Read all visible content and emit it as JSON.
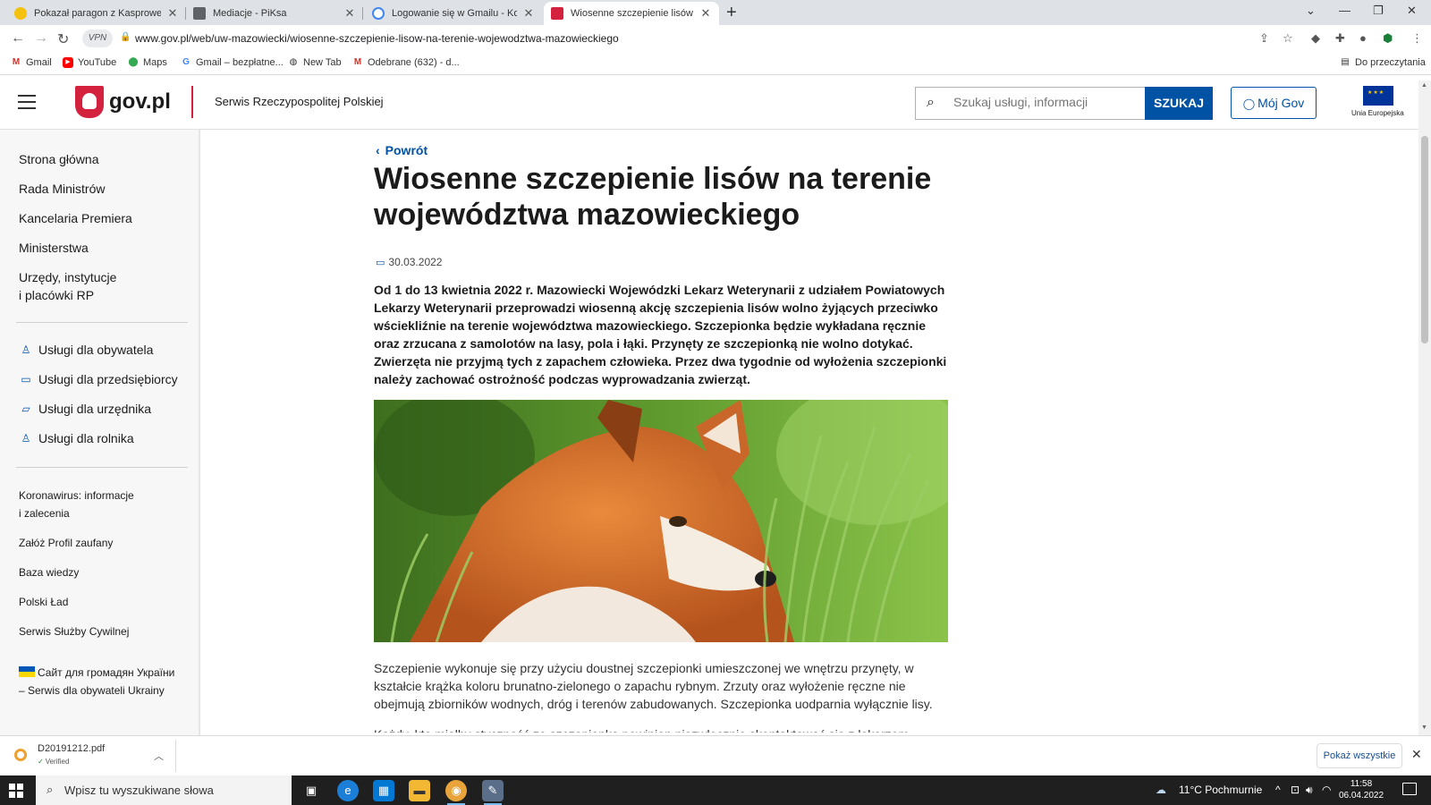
{
  "browser": {
    "tabs": [
      {
        "title": "Pokazał paragon z Kasprowego W",
        "color": "#f4c20d"
      },
      {
        "title": "Mediacje - PiKsa",
        "color": "#5f6368"
      },
      {
        "title": "Logowanie się w Gmailu - Kompu",
        "color": "#4285f4"
      },
      {
        "title": "Wiosenne szczepienie lisów na te",
        "color": "#d4213d"
      }
    ],
    "url": "www.gov.pl/web/uw-mazowiecki/wiosenne-szczepienie-lisow-na-terenie-wojewodztwa-mazowieckiego",
    "vpn_label": "VPN",
    "bookmarks": [
      "Gmail",
      "YouTube",
      "Maps",
      "Gmail – bezpłatne...",
      "New Tab",
      "Odebrane (632) - d..."
    ],
    "reading_list": "Do przeczytania"
  },
  "header": {
    "logo": "gov.pl",
    "service": "Serwis Rzeczypospolitej Polskiej",
    "search_placeholder": "Szukaj usługi, informacji",
    "search_button": "SZUKAJ",
    "account_button": "Mój Gov",
    "eu_label": "Unia Europejska"
  },
  "sidebar": {
    "nav": [
      "Strona główna",
      "Rada Ministrów",
      "Kancelaria Premiera",
      "Ministerstwa"
    ],
    "nav_multiline_1": "Urzędy, instytucje",
    "nav_multiline_2": "i placówki RP",
    "services": [
      {
        "label": "Usługi dla obywatela",
        "icon": "person-icon"
      },
      {
        "label": "Usługi dla przedsiębiorcy",
        "icon": "briefcase-icon"
      },
      {
        "label": "Usługi dla urzędnika",
        "icon": "laptop-icon"
      },
      {
        "label": "Usługi dla rolnika",
        "icon": "person-icon"
      }
    ],
    "covid_1": "Koronawirus: informacje",
    "covid_2": "i zalecenia",
    "links": [
      "Załóż Profil zaufany",
      "Baza wiedzy",
      "Polski Ład",
      "Serwis Służby Cywilnej"
    ],
    "ukraine_1": "Сайт для громадян України",
    "ukraine_2": "– Serwis dla obywateli Ukrainy"
  },
  "article": {
    "back": "Powrót",
    "title": "Wiosenne szczepienie lisów na terenie województwa mazowieckiego",
    "date": "30.03.2022",
    "lead": "Od 1 do 13 kwietnia 2022 r. Mazowiecki Wojewódzki Lekarz Weterynarii z udziałem Powiatowych Lekarzy Weterynarii przeprowadzi wiosenną akcję szczepienia lisów wolno żyjących przeciwko wściekliźnie na terenie województwa mazowieckiego. Szczepionka będzie wykładana ręcznie oraz zrzucana z samolotów na lasy, pola i łąki. Przynęty ze szczepionką nie wolno dotykać. Zwierzęta nie przyjmą tych z zapachem człowieka. Przez dwa tygodnie od wyłożenia szczepionki należy zachować ostrożność podczas wyprowadzania zwierząt.",
    "body1": "Szczepienie wykonuje się przy użyciu doustnej szczepionki umieszczonej we wnętrzu przynęty, w kształcie krążka koloru brunatno-zielonego o zapachu rybnym. Zrzuty oraz wyłożenie ręczne nie obejmują zbiorników wodnych, dróg i terenów zabudowanych. Szczepionka uodparnia wyłącznie lisy.",
    "body2": "Każdy, kto miałby styczność ze szczepionką powinien niezwłocznie skontaktować się z lekarzem"
  },
  "download": {
    "file": "D20191212.pdf",
    "status": "Verified",
    "show_all": "Pokaż wszystkie"
  },
  "taskbar": {
    "search": "Wpisz tu wyszukiwane słowa",
    "weather": "11°C  Pochmurnie",
    "time": "11:58",
    "date": "06.04.2022"
  },
  "colors": {
    "gov_blue": "#0052a5",
    "gov_red": "#d4213d"
  }
}
